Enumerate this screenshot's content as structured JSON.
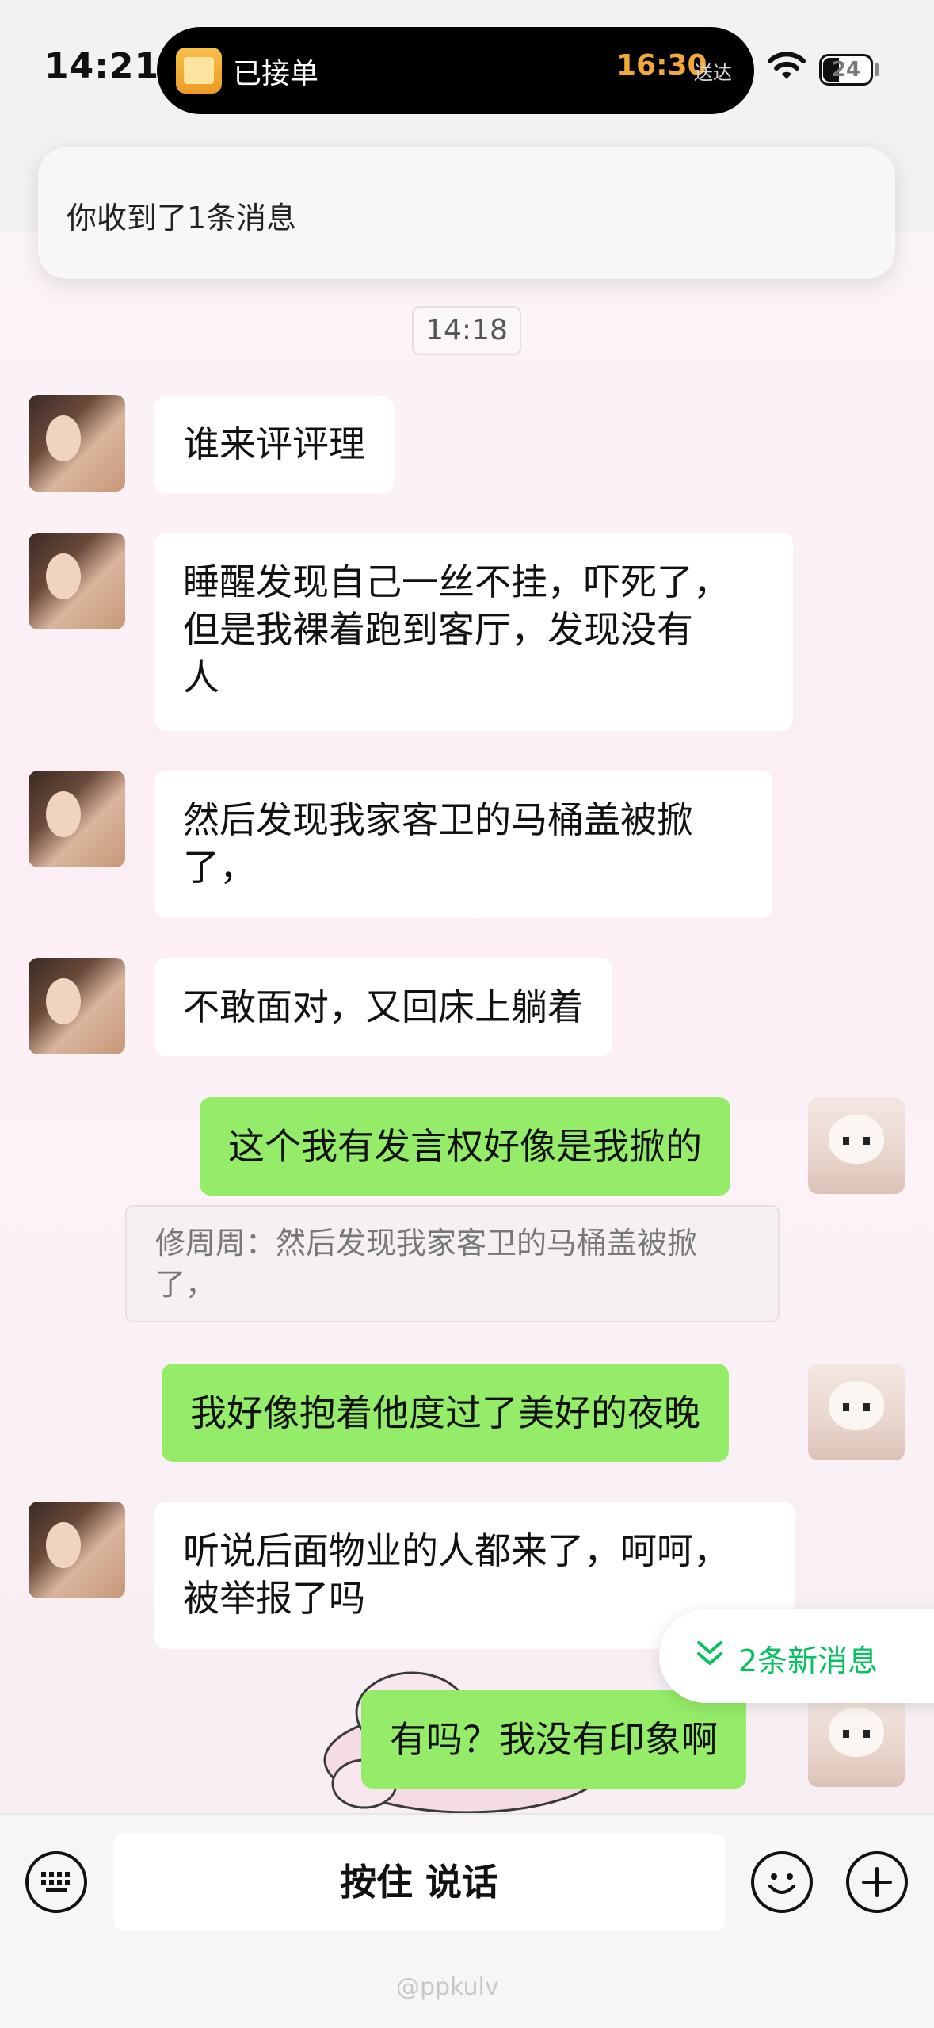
{
  "status_bar": {
    "time": "14:21",
    "island_status": "已接单",
    "island_eta": "16:30",
    "island_eta_suffix": "送达",
    "battery_level": "24"
  },
  "notification": {
    "text": "你收到了1条消息"
  },
  "chat": {
    "timestamp": "14:18",
    "messages": [
      {
        "side": "left",
        "text": "谁来评评理"
      },
      {
        "side": "left",
        "lines": [
          "睡醒发现自己一丝不挂，吓死了，",
          "但是我裸着跑到客厅，发现没有",
          "人"
        ]
      },
      {
        "side": "left",
        "lines": [
          "然后发现我家客卫的马桶盖被掀",
          "了，"
        ]
      },
      {
        "side": "left",
        "text": "不敢面对，又回床上躺着"
      },
      {
        "side": "right",
        "text": "这个我有发言权好像是我掀的"
      },
      {
        "side": "right",
        "text": "我好像抱着他度过了美好的夜晚"
      },
      {
        "side": "left",
        "lines": [
          "听说后面物业的人都来了，呵呵，",
          "被举报了吗"
        ]
      },
      {
        "side": "right",
        "text": "有吗？我没有印象啊"
      }
    ],
    "quote": {
      "lines": [
        "修周周：然后发现我家客卫的马桶盖被掀",
        "了，"
      ]
    },
    "new_messages_label": "2条新消息"
  },
  "input_bar": {
    "voice_label": "按住 说话"
  },
  "watermark": "@ppkulv",
  "colors": {
    "sent_bubble": "#95ec69",
    "accent_green": "#07c160",
    "received_bubble": "#ffffff"
  }
}
